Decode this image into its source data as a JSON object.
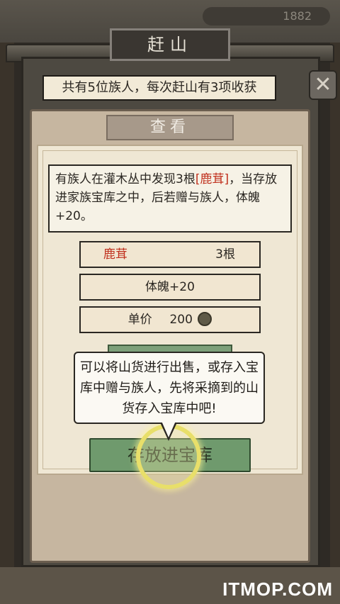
{
  "header": {
    "title": "赶山",
    "top_counter": "1882"
  },
  "info_bar": "共有5位族人，每次赶山有3项收获",
  "close_button": "✕",
  "tab_label": "查看",
  "message": {
    "part1": "有族人在灌木丛中发现3根",
    "highlight": "[鹿茸]",
    "part2": "，当存放进家族宝库之中，后若赠与族人，体魄+20。"
  },
  "items": {
    "item_name": "鹿茸",
    "item_qty": "3根",
    "effect": "体魄+20",
    "price_label": "单价",
    "price_value": "200"
  },
  "tooltip": "可以将山货进行出售，或存入宝库中赠与族人，先将采摘到的山货存入宝库中吧!",
  "store_button": "存放进宝库",
  "footer": {
    "watermark": "ITMOP.COM"
  },
  "colors": {
    "highlight": "#c0301d",
    "button_green": "#6f9a6d",
    "ring": "#e8df6a"
  }
}
